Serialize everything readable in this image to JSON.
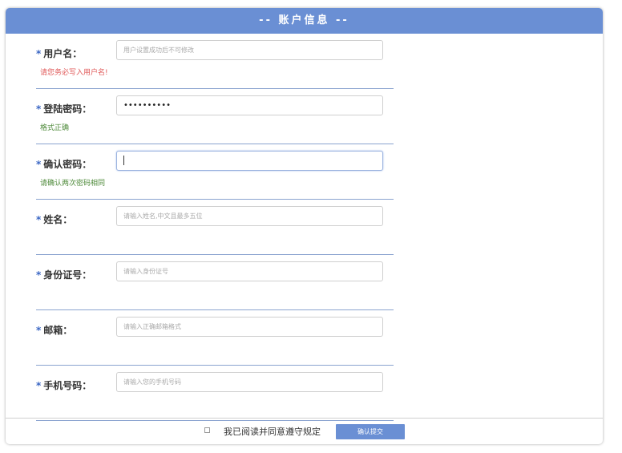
{
  "header": {
    "title": "-- 账户信息 --"
  },
  "fields": [
    {
      "required_mark": "*",
      "label": "用户名：",
      "value": "",
      "placeholder": "用户设置成功后不可修改",
      "hint": "请您务必写入用户名!"
    },
    {
      "required_mark": "*",
      "label": "登陆密码：",
      "value": "••••••••••",
      "placeholder": "",
      "hint": "格式正确"
    },
    {
      "required_mark": "*",
      "label": "确认密码：",
      "value": "",
      "placeholder": "",
      "hint": "请确认两次密码相同"
    },
    {
      "required_mark": "*",
      "label": "姓名：",
      "value": "",
      "placeholder": "请输入姓名,中文且最多五位",
      "hint": ""
    },
    {
      "required_mark": "*",
      "label": "身份证号：",
      "value": "",
      "placeholder": "请输入身份证号",
      "hint": ""
    },
    {
      "required_mark": "*",
      "label": "邮箱：",
      "value": "",
      "placeholder": "请输入正确邮箱格式",
      "hint": ""
    },
    {
      "required_mark": "*",
      "label": "手机号码：",
      "value": "",
      "placeholder": "请输入您的手机号码",
      "hint": ""
    }
  ],
  "footer": {
    "agree_label": "我已阅读并同意遵守规定",
    "agree_checked": false,
    "submit_label": "确认提交"
  },
  "colors": {
    "accent": "#6a8fd4",
    "required_mark": "#3a66c4",
    "error_hint": "#e05a5a",
    "ok_hint": "#4e8a3a"
  }
}
